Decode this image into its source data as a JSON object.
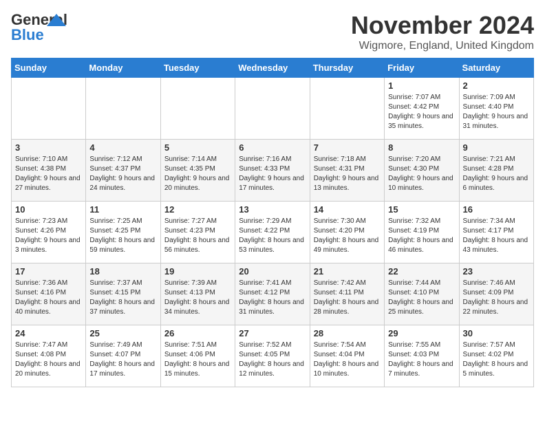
{
  "logo": {
    "line1": "General",
    "line2": "Blue"
  },
  "title": "November 2024",
  "location": "Wigmore, England, United Kingdom",
  "days_of_week": [
    "Sunday",
    "Monday",
    "Tuesday",
    "Wednesday",
    "Thursday",
    "Friday",
    "Saturday"
  ],
  "weeks": [
    [
      {
        "day": "",
        "info": ""
      },
      {
        "day": "",
        "info": ""
      },
      {
        "day": "",
        "info": ""
      },
      {
        "day": "",
        "info": ""
      },
      {
        "day": "",
        "info": ""
      },
      {
        "day": "1",
        "info": "Sunrise: 7:07 AM\nSunset: 4:42 PM\nDaylight: 9 hours and 35 minutes."
      },
      {
        "day": "2",
        "info": "Sunrise: 7:09 AM\nSunset: 4:40 PM\nDaylight: 9 hours and 31 minutes."
      }
    ],
    [
      {
        "day": "3",
        "info": "Sunrise: 7:10 AM\nSunset: 4:38 PM\nDaylight: 9 hours and 27 minutes."
      },
      {
        "day": "4",
        "info": "Sunrise: 7:12 AM\nSunset: 4:37 PM\nDaylight: 9 hours and 24 minutes."
      },
      {
        "day": "5",
        "info": "Sunrise: 7:14 AM\nSunset: 4:35 PM\nDaylight: 9 hours and 20 minutes."
      },
      {
        "day": "6",
        "info": "Sunrise: 7:16 AM\nSunset: 4:33 PM\nDaylight: 9 hours and 17 minutes."
      },
      {
        "day": "7",
        "info": "Sunrise: 7:18 AM\nSunset: 4:31 PM\nDaylight: 9 hours and 13 minutes."
      },
      {
        "day": "8",
        "info": "Sunrise: 7:20 AM\nSunset: 4:30 PM\nDaylight: 9 hours and 10 minutes."
      },
      {
        "day": "9",
        "info": "Sunrise: 7:21 AM\nSunset: 4:28 PM\nDaylight: 9 hours and 6 minutes."
      }
    ],
    [
      {
        "day": "10",
        "info": "Sunrise: 7:23 AM\nSunset: 4:26 PM\nDaylight: 9 hours and 3 minutes."
      },
      {
        "day": "11",
        "info": "Sunrise: 7:25 AM\nSunset: 4:25 PM\nDaylight: 8 hours and 59 minutes."
      },
      {
        "day": "12",
        "info": "Sunrise: 7:27 AM\nSunset: 4:23 PM\nDaylight: 8 hours and 56 minutes."
      },
      {
        "day": "13",
        "info": "Sunrise: 7:29 AM\nSunset: 4:22 PM\nDaylight: 8 hours and 53 minutes."
      },
      {
        "day": "14",
        "info": "Sunrise: 7:30 AM\nSunset: 4:20 PM\nDaylight: 8 hours and 49 minutes."
      },
      {
        "day": "15",
        "info": "Sunrise: 7:32 AM\nSunset: 4:19 PM\nDaylight: 8 hours and 46 minutes."
      },
      {
        "day": "16",
        "info": "Sunrise: 7:34 AM\nSunset: 4:17 PM\nDaylight: 8 hours and 43 minutes."
      }
    ],
    [
      {
        "day": "17",
        "info": "Sunrise: 7:36 AM\nSunset: 4:16 PM\nDaylight: 8 hours and 40 minutes."
      },
      {
        "day": "18",
        "info": "Sunrise: 7:37 AM\nSunset: 4:15 PM\nDaylight: 8 hours and 37 minutes."
      },
      {
        "day": "19",
        "info": "Sunrise: 7:39 AM\nSunset: 4:13 PM\nDaylight: 8 hours and 34 minutes."
      },
      {
        "day": "20",
        "info": "Sunrise: 7:41 AM\nSunset: 4:12 PM\nDaylight: 8 hours and 31 minutes."
      },
      {
        "day": "21",
        "info": "Sunrise: 7:42 AM\nSunset: 4:11 PM\nDaylight: 8 hours and 28 minutes."
      },
      {
        "day": "22",
        "info": "Sunrise: 7:44 AM\nSunset: 4:10 PM\nDaylight: 8 hours and 25 minutes."
      },
      {
        "day": "23",
        "info": "Sunrise: 7:46 AM\nSunset: 4:09 PM\nDaylight: 8 hours and 22 minutes."
      }
    ],
    [
      {
        "day": "24",
        "info": "Sunrise: 7:47 AM\nSunset: 4:08 PM\nDaylight: 8 hours and 20 minutes."
      },
      {
        "day": "25",
        "info": "Sunrise: 7:49 AM\nSunset: 4:07 PM\nDaylight: 8 hours and 17 minutes."
      },
      {
        "day": "26",
        "info": "Sunrise: 7:51 AM\nSunset: 4:06 PM\nDaylight: 8 hours and 15 minutes."
      },
      {
        "day": "27",
        "info": "Sunrise: 7:52 AM\nSunset: 4:05 PM\nDaylight: 8 hours and 12 minutes."
      },
      {
        "day": "28",
        "info": "Sunrise: 7:54 AM\nSunset: 4:04 PM\nDaylight: 8 hours and 10 minutes."
      },
      {
        "day": "29",
        "info": "Sunrise: 7:55 AM\nSunset: 4:03 PM\nDaylight: 8 hours and 7 minutes."
      },
      {
        "day": "30",
        "info": "Sunrise: 7:57 AM\nSunset: 4:02 PM\nDaylight: 8 hours and 5 minutes."
      }
    ]
  ]
}
